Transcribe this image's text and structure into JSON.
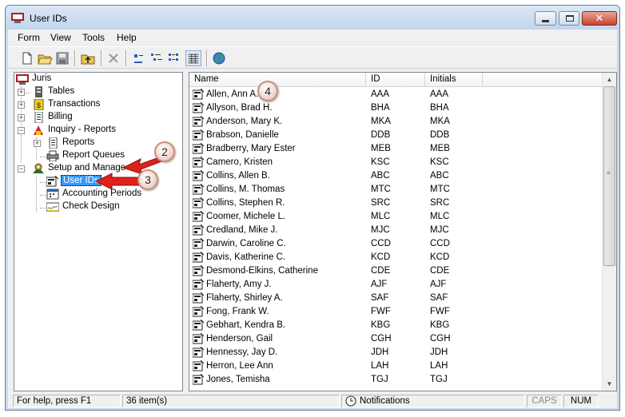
{
  "window": {
    "title": "User IDs"
  },
  "menu": [
    "Form",
    "View",
    "Tools",
    "Help"
  ],
  "toolbar": [
    "new-icon",
    "open-icon",
    "save-icon",
    "up-folder-icon",
    "delete-icon",
    "large-icons-icon",
    "small-icons-icon",
    "list-view-icon",
    "details-view-icon",
    "globe-icon"
  ],
  "tree": {
    "root": "Juris",
    "tables": "Tables",
    "transactions": "Transactions",
    "billing": "Billing",
    "inquiry": "Inquiry - Reports",
    "reports": "Reports",
    "report_queues": "Report Queues",
    "setup": "Setup and Manage",
    "user_ids": "User IDs",
    "accounting_periods": "Accounting Periods",
    "check_design": "Check Design"
  },
  "list": {
    "columns": {
      "name": "Name",
      "id": "ID",
      "initials": "Initials"
    },
    "rows": [
      {
        "name": "Allen, Ann A.",
        "id": "AAA",
        "initials": "AAA"
      },
      {
        "name": "Allyson, Brad H.",
        "id": "BHA",
        "initials": "BHA"
      },
      {
        "name": "Anderson, Mary K.",
        "id": "MKA",
        "initials": "MKA"
      },
      {
        "name": "Brabson, Danielle",
        "id": "DDB",
        "initials": "DDB"
      },
      {
        "name": "Bradberry, Mary Ester",
        "id": "MEB",
        "initials": "MEB"
      },
      {
        "name": "Camero, Kristen",
        "id": "KSC",
        "initials": "KSC"
      },
      {
        "name": "Collins, Allen B.",
        "id": "ABC",
        "initials": "ABC"
      },
      {
        "name": "Collins, M. Thomas",
        "id": "MTC",
        "initials": "MTC"
      },
      {
        "name": "Collins, Stephen R.",
        "id": "SRC",
        "initials": "SRC"
      },
      {
        "name": "Coomer, Michele L.",
        "id": "MLC",
        "initials": "MLC"
      },
      {
        "name": "Credland, Mike J.",
        "id": "MJC",
        "initials": "MJC"
      },
      {
        "name": "Darwin, Caroline C.",
        "id": "CCD",
        "initials": "CCD"
      },
      {
        "name": "Davis, Katherine C.",
        "id": "KCD",
        "initials": "KCD"
      },
      {
        "name": "Desmond-Elkins, Catherine",
        "id": "CDE",
        "initials": "CDE"
      },
      {
        "name": "Flaherty, Amy J.",
        "id": "AJF",
        "initials": "AJF"
      },
      {
        "name": "Flaherty, Shirley A.",
        "id": "SAF",
        "initials": "SAF"
      },
      {
        "name": "Fong, Frank W.",
        "id": "FWF",
        "initials": "FWF"
      },
      {
        "name": "Gebhart, Kendra B.",
        "id": "KBG",
        "initials": "KBG"
      },
      {
        "name": "Henderson, Gail",
        "id": "CGH",
        "initials": "CGH"
      },
      {
        "name": "Hennessy, Jay D.",
        "id": "JDH",
        "initials": "JDH"
      },
      {
        "name": "Herron, Lee Ann",
        "id": "LAH",
        "initials": "LAH"
      },
      {
        "name": "Jones, Temisha",
        "id": "TGJ",
        "initials": "TGJ"
      }
    ]
  },
  "status": {
    "help": "For help, press F1",
    "count": "36 item(s)",
    "notifications": "Notifications",
    "caps": "CAPS",
    "num": "NUM"
  },
  "callouts": {
    "two": "2",
    "three": "3",
    "four": "4"
  },
  "colors": {
    "selection": "#3399ff",
    "callout_arrow": "#e0201b",
    "close_button": "#c8422f"
  }
}
